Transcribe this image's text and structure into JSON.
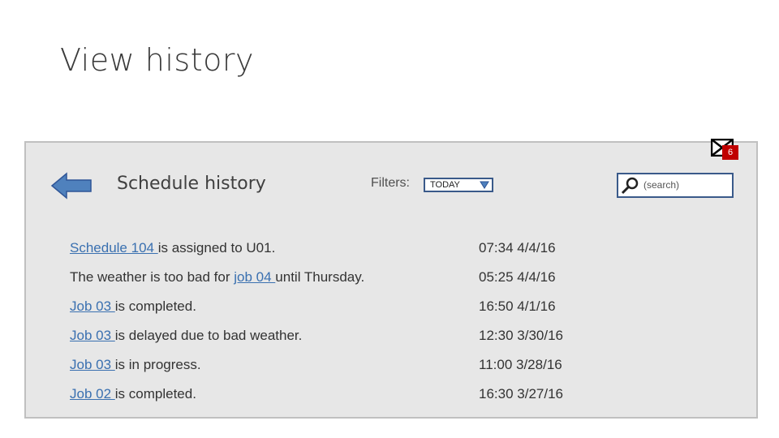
{
  "slide_title": "View history",
  "notifications": {
    "count": "6"
  },
  "header": {
    "title": "Schedule history",
    "filters_label": "Filters:",
    "filter_value": "TODAY",
    "search_placeholder": "(search)"
  },
  "history": [
    {
      "link": "Schedule 104 ",
      "pre": "",
      "post": "is assigned to U01.",
      "time": "07:34 4/4/16"
    },
    {
      "pre": "The weather is too bad for ",
      "link": "job 04 ",
      "post": "until Thursday.",
      "time": "05:25 4/4/16"
    },
    {
      "pre": "",
      "link": "Job 03 ",
      "post": "is completed.",
      "time": "16:50 4/1/16"
    },
    {
      "pre": "",
      "link": "Job 03 ",
      "post": "is delayed due to bad weather.",
      "time": "12:30 3/30/16"
    },
    {
      "pre": "",
      "link": "Job 03 ",
      "post": "is in progress.",
      "time": "11:00 3/28/16"
    },
    {
      "pre": "",
      "link": "Job 02 ",
      "post": "is completed.",
      "time": "16:30 3/27/16"
    }
  ],
  "colors": {
    "panel_bg": "#e7e7e7",
    "link": "#3a70b0",
    "accent": "#4f81bd",
    "badge": "#c00000"
  },
  "icons": [
    "back-arrow-icon",
    "mail-icon",
    "dropdown-caret-icon",
    "search-icon"
  ]
}
